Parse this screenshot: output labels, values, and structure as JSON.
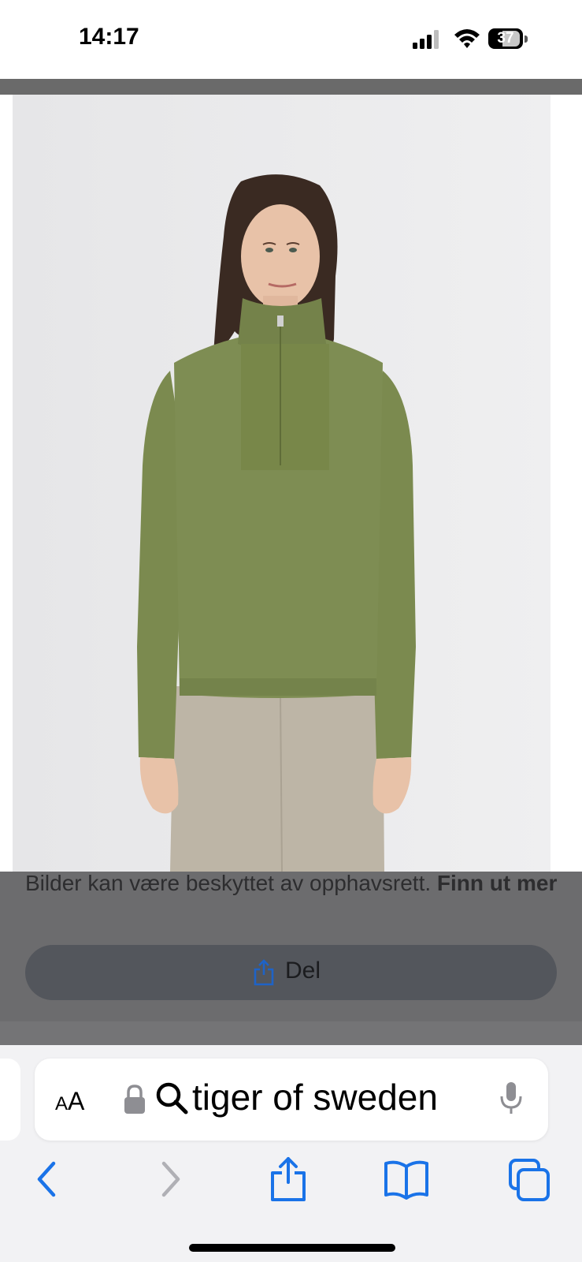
{
  "status_bar": {
    "time": "14:17",
    "battery_level": "37",
    "icons": [
      "cellular-signal-icon",
      "wifi-icon",
      "battery-icon"
    ]
  },
  "image_viewer": {
    "image_subject": "product-photo-green-half-zip-sweater",
    "caption_text": "Bilder kan være beskyttet av opphavsrett. ",
    "caption_link": "Finn ut mer",
    "share_label": "Del",
    "colors": {
      "overlay": "#6c6c6e",
      "share_button": "#53565c",
      "share_icon": "#1e63c7"
    }
  },
  "address_bar": {
    "text_size_label_small": "A",
    "text_size_label_big": "A",
    "query": "tiger of sweden",
    "icons": [
      "lock-icon",
      "search-icon",
      "microphone-icon"
    ]
  },
  "toolbar": {
    "items": [
      "back-icon",
      "forward-icon",
      "share-icon",
      "bookmarks-icon",
      "tabs-icon"
    ],
    "accent": "#1a73e8"
  }
}
